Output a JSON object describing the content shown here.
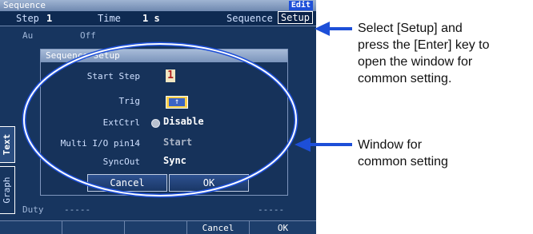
{
  "window": {
    "title": "Sequence",
    "edit_badge": "Edit"
  },
  "infobar": {
    "step_label": "Step",
    "step_value": "1",
    "time_label": "Time",
    "time_value": "1 s",
    "sequence_label": "Sequence",
    "setup_button": "Setup"
  },
  "side_tabs": {
    "text": "Text",
    "graph": "Graph"
  },
  "background": {
    "duty_label": "Duty",
    "duty_value": "-----",
    "duty_value_right": "-----",
    "off_text": "Off"
  },
  "dialog": {
    "title": "Sequence Setup",
    "start_step_label": "Start Step",
    "start_step_value": "1",
    "trig_label": "Trig",
    "extctrl_label": "ExtCtrl",
    "extctrl_value": "Disable",
    "multi_io_label": "Multi I/O pin14",
    "multi_io_value": "Start",
    "syncout_label": "SyncOut",
    "syncout_value": "Sync",
    "cancel_button": "Cancel",
    "ok_button": "OK"
  },
  "function_keys": [
    "",
    "",
    "",
    "Cancel",
    "OK"
  ],
  "annotations": {
    "top_note": [
      "Select [Setup] and",
      "press the [Enter] key to",
      "open the window for",
      "common setting."
    ],
    "bottom_note": [
      "Window for",
      "common setting"
    ]
  },
  "colors": {
    "screen_bg": "#17355f",
    "accent_blue": "#1d4fd8",
    "highlight_ellipse": "#ffffff",
    "arrow_blue": "#1d4fd8"
  }
}
